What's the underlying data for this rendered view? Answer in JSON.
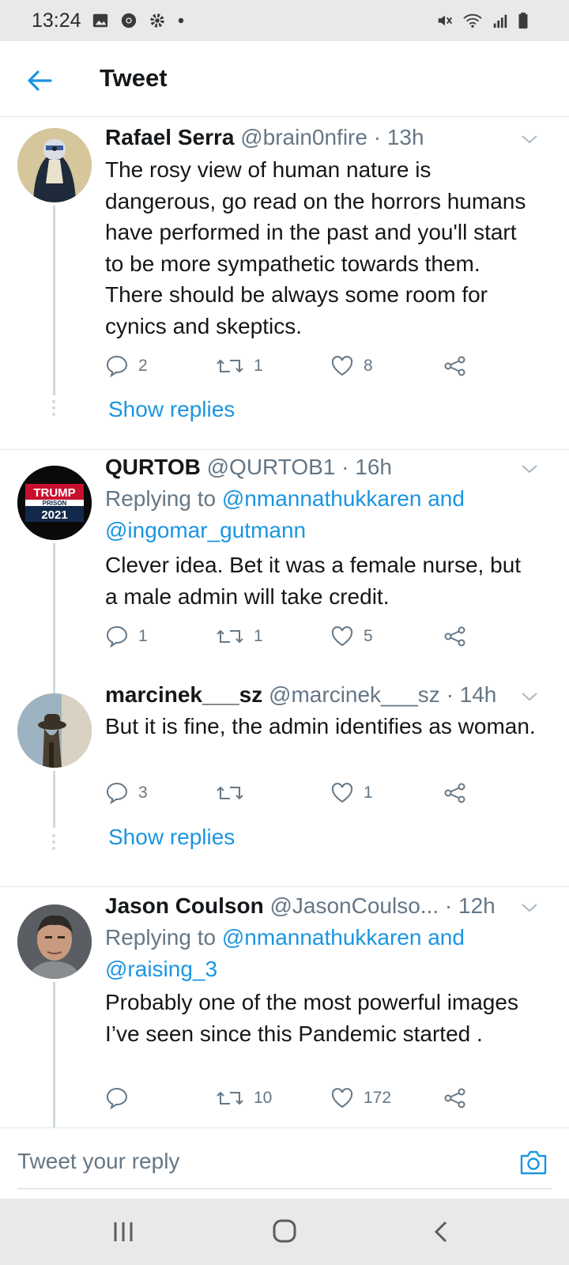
{
  "status_bar": {
    "time": "13:24",
    "left_icons": [
      "image-icon",
      "chrome-icon",
      "settings-icon",
      "dot-icon"
    ],
    "right_icons": [
      "mute-icon",
      "wifi-icon",
      "signal-icon",
      "battery-icon"
    ]
  },
  "header": {
    "title": "Tweet",
    "back_icon": "arrow-left-icon"
  },
  "colors": {
    "accent": "#1b95e0",
    "text": "#14171a",
    "secondary": "#657786",
    "divider": "#e1e8ed"
  },
  "tweets": [
    {
      "name": "Rafael Serra",
      "handle": "@brain0nfire",
      "time": "· 13h",
      "body": "The rosy view of human nature is dangerous, go read on the horrors humans have performed in the past and you'll start to be more sympathetic towards them. There should be always some room for cynics and skeptics.",
      "replies": "2",
      "retweets": "1",
      "likes": "8",
      "show_replies": "Show replies"
    },
    {
      "name": "QURTOB",
      "handle": "@QURTOB1",
      "time": "· 16h",
      "replying_prefix": "Replying to",
      "replying_to": "@nmannathukkaren and @ingomar_gutmann",
      "avatar_text": {
        "line1": "TRUMP",
        "line2": "PRISON",
        "line3": "2021"
      },
      "body": "Clever idea.  Bet it was a female nurse, but a male admin will take credit.",
      "replies": "1",
      "retweets": "1",
      "likes": "5"
    },
    {
      "name": "marcinek___sz",
      "handle": "@marcinek___sz",
      "time": "· 14h",
      "body": "But it is fine, the admin identifies as woman.",
      "replies": "3",
      "retweets": "",
      "likes": "1",
      "show_replies": "Show replies"
    },
    {
      "name": "Jason Coulson",
      "handle": "@JasonCoulso...",
      "time": "· 12h",
      "replying_prefix": "Replying to",
      "replying_to": "@nmannathukkaren and @raising_3",
      "body": "Probably one of the most powerful images I’ve seen since this Pandemic started .",
      "replies": "",
      "retweets": "10",
      "likes": "172"
    }
  ],
  "compose": {
    "placeholder": "Tweet your reply",
    "camera_icon": "camera-icon"
  },
  "nav_bar": {
    "icons": [
      "recent-apps-icon",
      "home-icon",
      "back-icon"
    ]
  }
}
